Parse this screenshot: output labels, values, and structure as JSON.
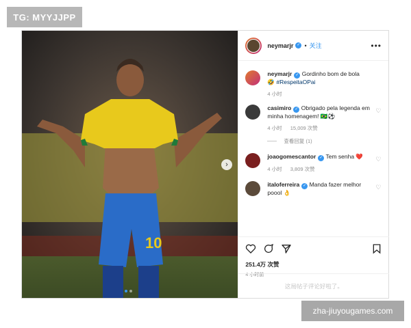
{
  "watermarks": {
    "top_left": "TG: MYYJJPP",
    "bottom_right": "zha-jiuyougames.com"
  },
  "post": {
    "username": "neymarjr",
    "follow_label": "关注",
    "separator": "•",
    "more_label": "•••",
    "caption": {
      "user": "neymarjr",
      "text": "Gordinho bom de bola",
      "emoji": "🤣",
      "hashtag": "#RespeitaOPai",
      "time": "4 小时"
    },
    "comments": [
      {
        "user": "casimiro",
        "text": "Obrigado pela legenda em minha homenagem! 🇧🇷⚽",
        "time": "4 小时",
        "likes": "15,009 次赞",
        "replies": "查看回复 (1)"
      },
      {
        "user": "joaogomescantor",
        "text": "Tem senha ❤️",
        "time": "4 小时",
        "likes": "3,809 次赞"
      },
      {
        "user": "italoferreira",
        "text": "Manda fazer melhor poool 👌"
      }
    ],
    "likes_count": "251.4万 次赞",
    "post_time": "4 小时前",
    "add_comment_placeholder": "这局帖子评论好啦了。",
    "carousel": {
      "current": 1,
      "total": 2
    }
  }
}
